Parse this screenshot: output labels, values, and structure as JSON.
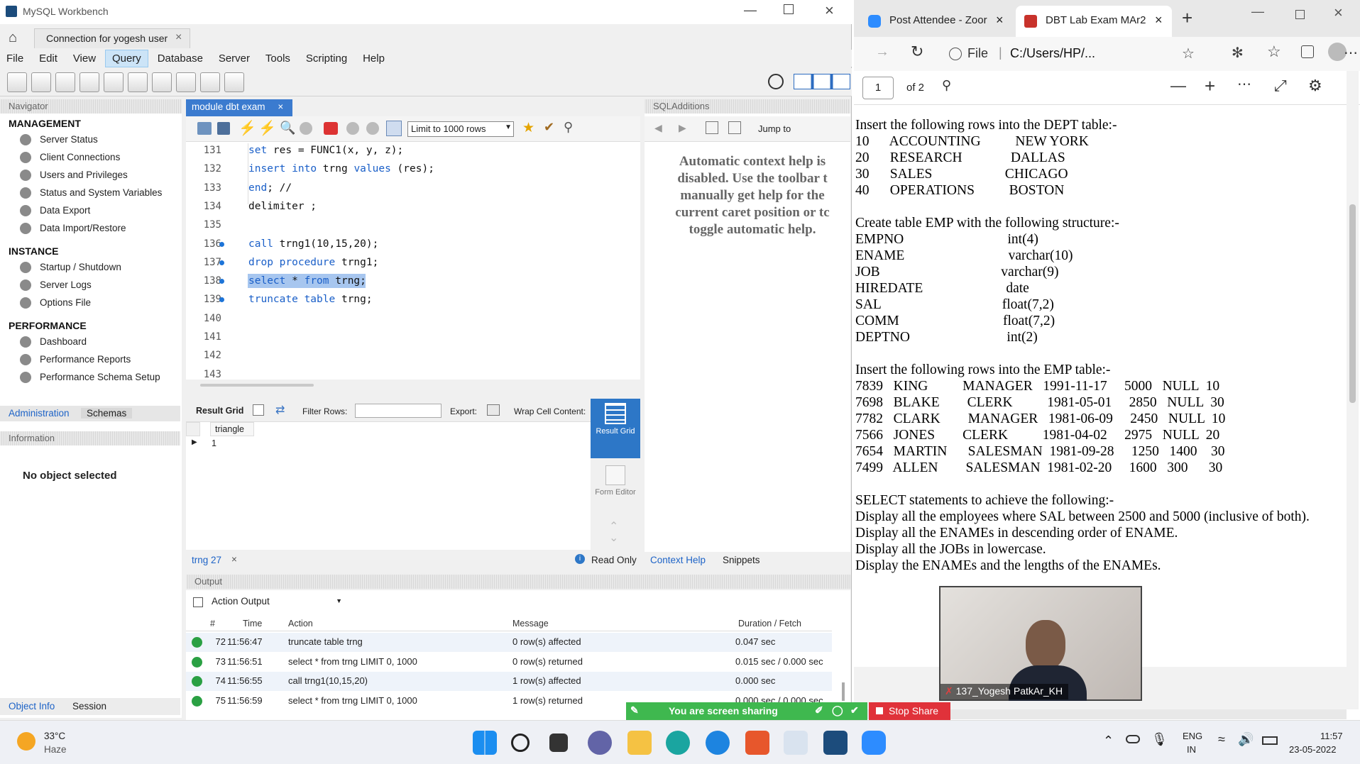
{
  "workbench": {
    "title": "MySQL Workbench",
    "connection_tab": "Connection for yogesh user",
    "menu": [
      "File",
      "Edit",
      "View",
      "Query",
      "Database",
      "Server",
      "Tools",
      "Scripting",
      "Help"
    ],
    "navigator": {
      "header": "Navigator",
      "management_title": "MANAGEMENT",
      "management": [
        "Server Status",
        "Client Connections",
        "Users and Privileges",
        "Status and System Variables",
        "Data Export",
        "Data Import/Restore"
      ],
      "instance_title": "INSTANCE",
      "instance": [
        "Startup / Shutdown",
        "Server Logs",
        "Options File"
      ],
      "performance_title": "PERFORMANCE",
      "performance": [
        "Dashboard",
        "Performance Reports",
        "Performance Schema Setup"
      ],
      "tabs": [
        "Administration",
        "Schemas"
      ],
      "info_header": "Information",
      "no_object": "No object selected",
      "bottom_tabs": [
        "Object Info",
        "Session"
      ]
    },
    "editor": {
      "tab": "module dbt exam",
      "limit_select": "Limit to 1000 rows",
      "lines": [
        {
          "n": "131",
          "code": "set res = FUNC1(x, y, z);"
        },
        {
          "n": "132",
          "code": "insert into trng values (res);"
        },
        {
          "n": "133",
          "code": "end; //"
        },
        {
          "n": "134",
          "code": "delimiter ;"
        },
        {
          "n": "135",
          "code": ""
        },
        {
          "n": "136",
          "code": "call trng1(10,15,20);"
        },
        {
          "n": "137",
          "code": "drop procedure trng1;"
        },
        {
          "n": "138",
          "code": "select * from trng;"
        },
        {
          "n": "139",
          "code": "truncate table trng;"
        },
        {
          "n": "140",
          "code": ""
        },
        {
          "n": "141",
          "code": ""
        },
        {
          "n": "142",
          "code": ""
        },
        {
          "n": "143",
          "code": ""
        }
      ]
    },
    "result": {
      "result_grid_label": "Result Grid",
      "filter_label": "Filter Rows:",
      "export_label": "Export:",
      "wrap_label": "Wrap Cell Content:",
      "column": "triangle",
      "value": "1",
      "side_result": "Result Grid",
      "side_form": "Form Editor",
      "tab": "trng 27",
      "read_only": "Read Only"
    },
    "sql_additions": {
      "header": "SQLAdditions",
      "jump_to": "Jump to",
      "help_text": [
        "Automatic context help is",
        "disabled. Use the toolbar t",
        "manually get help for the",
        "current caret position or tc",
        "toggle automatic help."
      ],
      "tabs": [
        "Context Help",
        "Snippets"
      ]
    },
    "output": {
      "header": "Output",
      "dropdown": "Action Output",
      "columns": [
        "#",
        "Time",
        "Action",
        "Message",
        "Duration / Fetch"
      ],
      "rows": [
        {
          "n": "72",
          "time": "11:56:47",
          "action": "truncate table trng",
          "msg": "0 row(s) affected",
          "dur": "0.047 sec"
        },
        {
          "n": "73",
          "time": "11:56:51",
          "action": "select * from trng LIMIT 0, 1000",
          "msg": "0 row(s) returned",
          "dur": "0.015 sec / 0.000 sec"
        },
        {
          "n": "74",
          "time": "11:56:55",
          "action": "call trng1(10,15,20)",
          "msg": "1 row(s) affected",
          "dur": "0.000 sec"
        },
        {
          "n": "75",
          "time": "11:56:59",
          "action": "select * from trng LIMIT 0, 1000",
          "msg": "1 row(s) returned",
          "dur": "0.000 sec / 0.000 sec"
        }
      ]
    }
  },
  "browser": {
    "tab1": "Post Attendee - Zoor",
    "tab2": "DBT Lab Exam MAr2",
    "address_label": "File",
    "address": "C:/Users/HP/...",
    "page_num": "1",
    "page_total": "of 2",
    "doc_lines": [
      "Insert the following rows into the DEPT table:-",
      "10      ACCOUNTING          NEW YORK",
      "20      RESEARCH              DALLAS",
      "30      SALES                     CHICAGO",
      "40      OPERATIONS          BOSTON",
      "",
      "Create table EMP with the following structure:-",
      "EMPNO                              int(4)",
      "ENAME                              varchar(10)",
      "JOB                                   varchar(9)",
      "HIREDATE                        date",
      "SAL                                   float(7,2)",
      "COMM                              float(7,2)",
      "DEPTNO                            int(2)",
      "",
      "Insert the following rows into the EMP table:-",
      "7839   KING          MANAGER   1991-11-17     5000   NULL  10",
      "7698   BLAKE        CLERK          1981-05-01     2850   NULL  30",
      "7782   CLARK        MANAGER   1981-06-09     2450   NULL  10",
      "7566   JONES        CLERK          1981-04-02     2975   NULL  20",
      "7654   MARTIN      SALESMAN  1981-09-28     1250   1400    30",
      "7499   ALLEN        SALESMAN  1981-02-20     1600   300      30",
      "",
      "SELECT statements to achieve the following:-",
      "Display all the employees where SAL between 2500 and 5000 (inclusive of both).",
      "Display all the ENAMEs in descending order of ENAME.",
      "Display all the JOBs in lowercase.",
      "Display the ENAMEs and the lengths of the ENAMEs."
    ],
    "webcam_name": "137_Yogesh PatkAr_KH"
  },
  "share": {
    "sharing": "You are screen sharing",
    "stop": "Stop Share"
  },
  "taskbar": {
    "weather_temp": "33°C",
    "weather_desc": "Haze",
    "lang1": "ENG",
    "lang2": "IN",
    "time": "11:57",
    "date": "23-05-2022"
  }
}
